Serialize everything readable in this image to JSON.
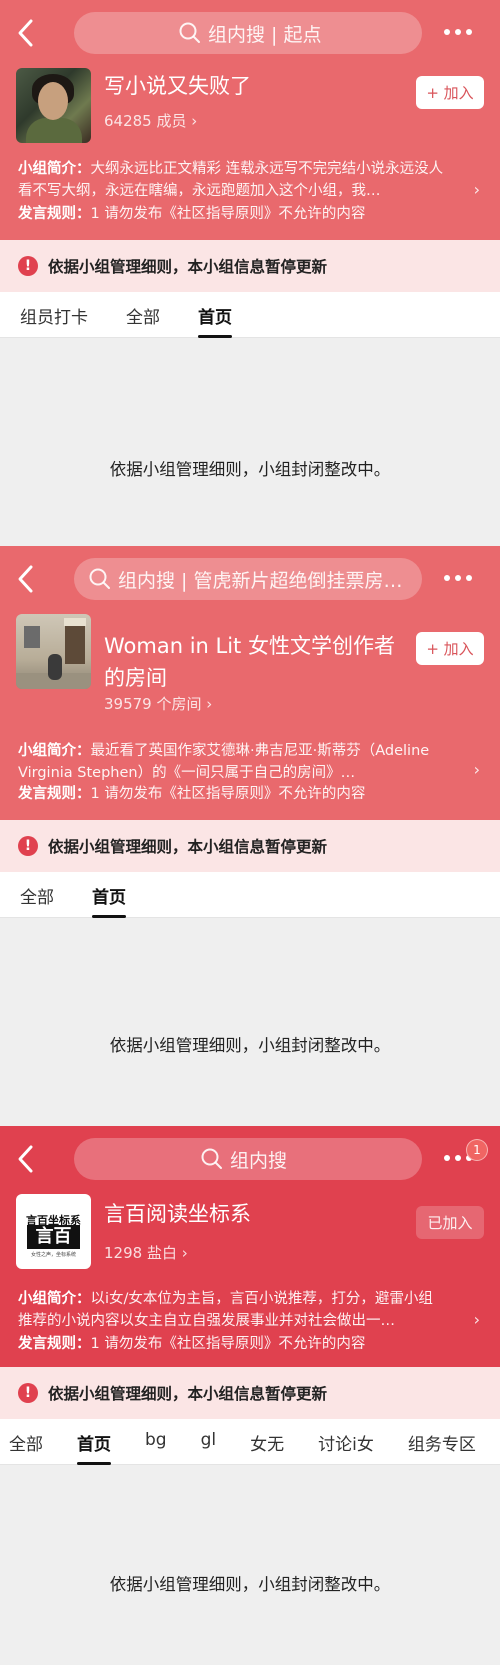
{
  "groups": [
    {
      "search_placeholder": "组内搜 | 起点",
      "name": "写小说又失败了",
      "members": "64285 成员 ›",
      "join_label": "+ 加入",
      "intro_label": "小组简介：",
      "intro_text": "大纲永远比正文精彩 连载永远写不完完结小说永远没人看不写大纲，永远在瞎编，永远跑题加入这个小组，我…",
      "rule_label": "发言规则：",
      "rule_text": "1 请勿发布《社区指导原则》不允许的内容",
      "notice": "依据小组管理细则，本小组信息暂停更新",
      "tabs": [
        "组员打卡",
        "全部",
        "首页"
      ],
      "active_tab": 2,
      "closed_message": "依据小组管理细则，小组封闭整改中。"
    },
    {
      "search_placeholder": "组内搜 | 管虎新片超绝倒挂票房…",
      "name": "Woman in Lit 女性文学创作者的房间",
      "members": "39579 个房间 ›",
      "join_label": "+ 加入",
      "intro_label": "小组简介：",
      "intro_text": "最近看了英国作家艾德琳·弗吉尼亚·斯蒂芬（Adeline Virginia Stephen）的《一间只属于自己的房间》…",
      "rule_label": "发言规则：",
      "rule_text": "1 请勿发布《社区指导原则》不允许的内容",
      "notice": "依据小组管理细则，本小组信息暂停更新",
      "tabs": [
        "全部",
        "首页"
      ],
      "active_tab": 1,
      "closed_message": "依据小组管理细则，小组封闭整改中。"
    },
    {
      "search_placeholder": "组内搜",
      "name": "言百阅读坐标系",
      "members": "1298 盐白 ›",
      "join_label": "已加入",
      "badge": "1",
      "avatar_logo_top": "言百坐标系",
      "avatar_logo_big": "言百",
      "avatar_logo_sub": "女性之声，坐标系统",
      "intro_label": "小组简介：",
      "intro_text": "以i女/女本位为主旨，言百小说推荐，打分，避雷小组 推荐的小说内容以女主自立自强发展事业并对社会做出一…",
      "rule_label": "发言规则：",
      "rule_text": "1 请勿发布《社区指导原则》不允许的内容",
      "notice": "依据小组管理细则，本小组信息暂停更新",
      "tabs": [
        "全部",
        "首页",
        "bg",
        "gl",
        "女无",
        "讨论i女",
        "组务专区"
      ],
      "active_tab": 1,
      "closed_message": "依据小组管理细则，小组封闭整改中。"
    }
  ],
  "colors": {
    "header_pink": "#e9696d",
    "header_red": "#e0414f",
    "notice_bg": "#fbe5e5"
  },
  "icons": {
    "back": "chevron-left-icon",
    "search": "search-icon",
    "more": "more-dots-icon",
    "warning": "warning-icon",
    "intro_more": "chevron-right-icon"
  }
}
